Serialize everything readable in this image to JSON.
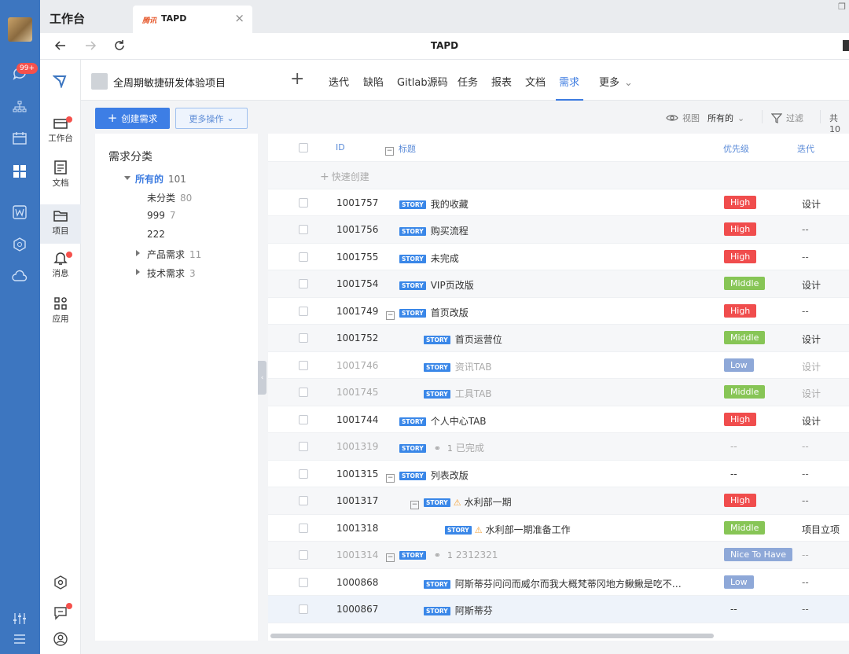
{
  "app": {
    "name": "工作台",
    "tab_title": "TAPD",
    "tab_logo": "腾讯",
    "page_title": "TAPD",
    "notif_badge": "99+"
  },
  "rail_icons": [
    "chat-icon",
    "org-icon",
    "calendar-icon",
    "apps-grid-icon",
    "word-icon",
    "box-icon",
    "cloud-icon",
    "sliders-icon",
    "menu-icon"
  ],
  "nav2": [
    {
      "label": "工作台",
      "icon": "workbench-icon"
    },
    {
      "label": "文档",
      "icon": "doc-icon"
    },
    {
      "label": "项目",
      "icon": "project-icon"
    },
    {
      "label": "消息",
      "icon": "bell-icon"
    },
    {
      "label": "应用",
      "icon": "apps-icon"
    }
  ],
  "project": {
    "name": "全周期敏捷研发体验项目",
    "tabs": [
      "迭代",
      "缺陷",
      "Gitlab源码",
      "任务",
      "报表",
      "文档",
      "需求",
      "更多"
    ],
    "active_tab": "需求"
  },
  "toolbar": {
    "create": "创建需求",
    "more_ops": "更多操作",
    "view_label": "视图",
    "view_value": "所有的",
    "filter": "过滤",
    "total": "共 10"
  },
  "category": {
    "title": "需求分类",
    "nodes": [
      {
        "label": "所有的",
        "count": "101"
      },
      {
        "label": "未分类",
        "count": "80"
      },
      {
        "label": "999",
        "count": "7"
      },
      {
        "label": "222",
        "count": ""
      },
      {
        "label": "产品需求",
        "count": "11"
      },
      {
        "label": "技术需求",
        "count": "3"
      }
    ]
  },
  "table": {
    "headers": {
      "id": "ID",
      "title": "标题",
      "priority": "优先级",
      "iteration": "迭代"
    },
    "quick_create": "快速创建",
    "rows": [
      {
        "id": "1001757",
        "title": "我的收藏",
        "priority": "High",
        "iteration": "设计"
      },
      {
        "id": "1001756",
        "title": "购买流程",
        "priority": "High",
        "iteration": "--"
      },
      {
        "id": "1001755",
        "title": "未完成",
        "priority": "High",
        "iteration": "--"
      },
      {
        "id": "1001754",
        "title": "VIP页改版",
        "priority": "Middle",
        "iteration": "设计"
      },
      {
        "id": "1001749",
        "title": "首页改版",
        "priority": "High",
        "iteration": "--"
      },
      {
        "id": "1001752",
        "title": "首页运营位",
        "priority": "Middle",
        "iteration": "设计"
      },
      {
        "id": "1001746",
        "title": "资讯TAB",
        "priority": "Low",
        "iteration": "设计"
      },
      {
        "id": "1001745",
        "title": "工具TAB",
        "priority": "Middle",
        "iteration": "设计"
      },
      {
        "id": "1001744",
        "title": "个人中心TAB",
        "priority": "High",
        "iteration": "设计"
      },
      {
        "id": "1001319",
        "title": "已完成",
        "link": "1",
        "priority": "--",
        "iteration": "--"
      },
      {
        "id": "1001315",
        "title": "列表改版",
        "priority": "--",
        "iteration": "--"
      },
      {
        "id": "1001317",
        "title": "水利部一期",
        "priority": "High",
        "iteration": "--"
      },
      {
        "id": "1001318",
        "title": "水利部一期准备工作",
        "priority": "Middle",
        "iteration": "项目立项"
      },
      {
        "id": "1001314",
        "title": "2312321",
        "link": "1",
        "priority": "Nice To Have",
        "iteration": "--"
      },
      {
        "id": "1000868",
        "title": "阿斯蒂芬问问而威尔而我大概梵蒂冈地方鳅鳅是吃不…",
        "priority": "Low",
        "iteration": "--"
      },
      {
        "id": "1000867",
        "title": "阿斯蒂芬",
        "priority": "--",
        "iteration": "--"
      }
    ]
  },
  "colors": {
    "rail": "#3d76c0",
    "accent": "#3d7ee5",
    "high": "#f04d4d",
    "middle": "#87c556",
    "low": "#8ea8d8",
    "nice": "#8ea8d8"
  }
}
